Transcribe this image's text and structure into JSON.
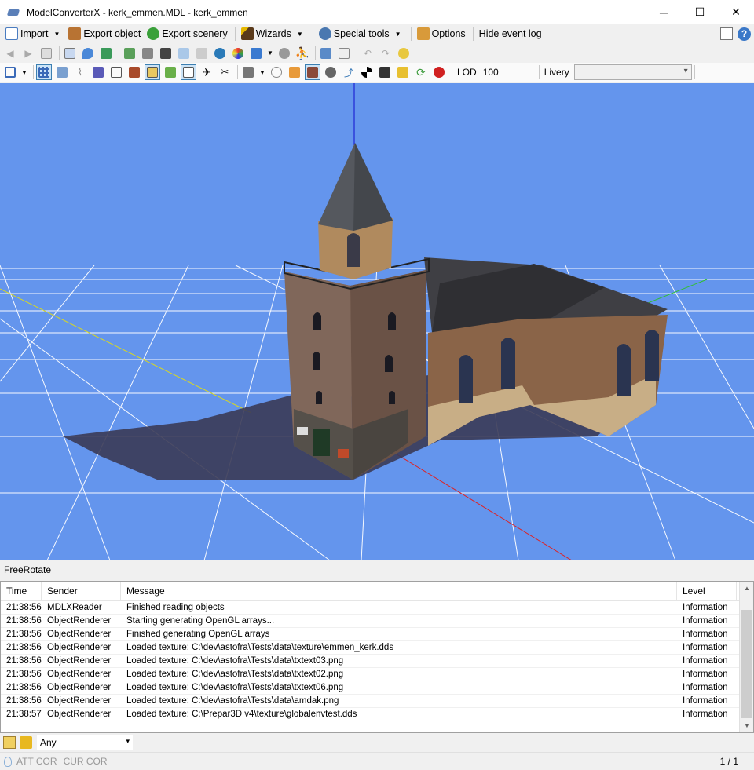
{
  "window": {
    "title": "ModelConverterX - kerk_emmen.MDL - kerk_emmen",
    "minimize": "─",
    "maximize": "☐",
    "close": "✕"
  },
  "menu": {
    "import": "Import",
    "export_object": "Export object",
    "export_scenery": "Export scenery",
    "wizards": "Wizards",
    "special_tools": "Special tools",
    "options": "Options",
    "hide_event_log": "Hide event log"
  },
  "toolbar": {
    "lod_label": "LOD",
    "lod_value": "100",
    "livery_label": "Livery",
    "livery_value": ""
  },
  "viewport": {
    "mode": "FreeRotate",
    "background": "#6495ed"
  },
  "log": {
    "columns": {
      "time": "Time",
      "sender": "Sender",
      "message": "Message",
      "level": "Level"
    },
    "rows": [
      {
        "time": "21:38:56",
        "sender": "MDLXReader",
        "message": "Finished reading objects",
        "level": "Information"
      },
      {
        "time": "21:38:56",
        "sender": "ObjectRenderer",
        "message": "Starting generating OpenGL arrays...",
        "level": "Information"
      },
      {
        "time": "21:38:56",
        "sender": "ObjectRenderer",
        "message": "Finished generating OpenGL arrays",
        "level": "Information"
      },
      {
        "time": "21:38:56",
        "sender": "ObjectRenderer",
        "message": "Loaded texture: C:\\dev\\astofra\\Tests\\data\\texture\\emmen_kerk.dds",
        "level": "Information"
      },
      {
        "time": "21:38:56",
        "sender": "ObjectRenderer",
        "message": "Loaded texture: C:\\dev\\astofra\\Tests\\data\\txtext03.png",
        "level": "Information"
      },
      {
        "time": "21:38:56",
        "sender": "ObjectRenderer",
        "message": "Loaded texture: C:\\dev\\astofra\\Tests\\data\\txtext02.png",
        "level": "Information"
      },
      {
        "time": "21:38:56",
        "sender": "ObjectRenderer",
        "message": "Loaded texture: C:\\dev\\astofra\\Tests\\data\\txtext06.png",
        "level": "Information"
      },
      {
        "time": "21:38:56",
        "sender": "ObjectRenderer",
        "message": "Loaded texture: C:\\dev\\astofra\\Tests\\data\\amdak.png",
        "level": "Information"
      },
      {
        "time": "21:38:57",
        "sender": "ObjectRenderer",
        "message": "Loaded texture: C:\\Prepar3D v4\\texture\\globalenvtest.dds",
        "level": "Information"
      }
    ]
  },
  "filter": {
    "value": "Any"
  },
  "status": {
    "att_cor": "ATT COR",
    "cur_cor": "CUR COR",
    "pages": "1 / 1"
  }
}
